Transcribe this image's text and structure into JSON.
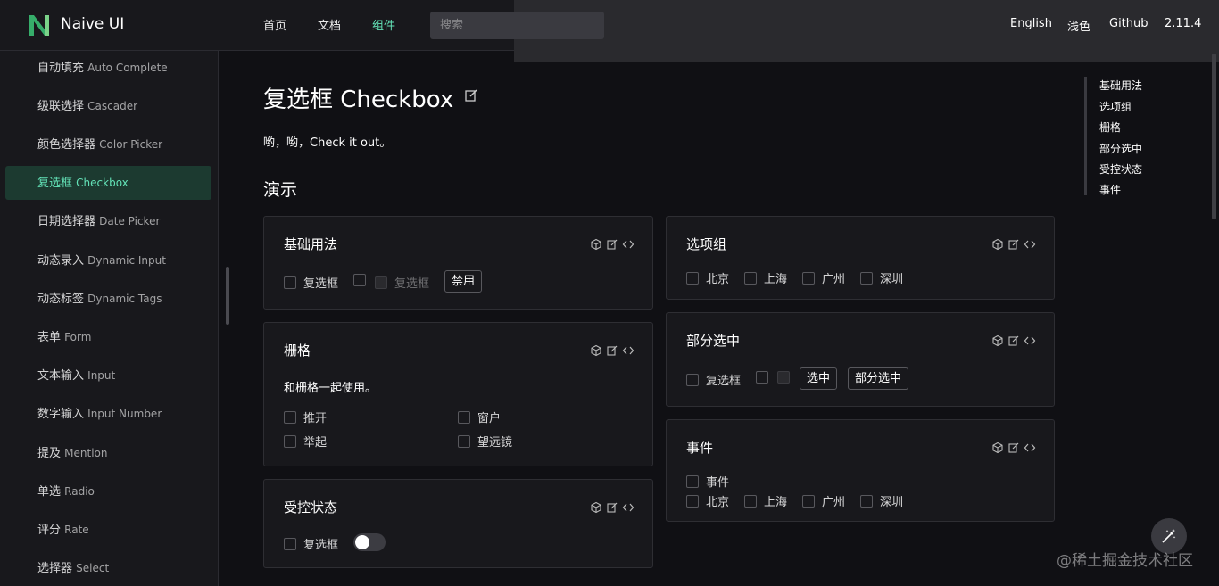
{
  "header": {
    "brand": "Naive UI",
    "nav": [
      "首页",
      "文档",
      "组件"
    ],
    "active_nav": "组件",
    "search_placeholder": "搜索",
    "right": [
      "English",
      "浅色",
      "Github",
      "2.11.4"
    ],
    "accent_color": "#63e2b7"
  },
  "sidebar": {
    "items": [
      {
        "zh": "自动填充",
        "en": "Auto Complete"
      },
      {
        "zh": "级联选择",
        "en": "Cascader"
      },
      {
        "zh": "颜色选择器",
        "en": "Color Picker"
      },
      {
        "zh": "复选框",
        "en": "Checkbox",
        "active": true
      },
      {
        "zh": "日期选择器",
        "en": "Date Picker"
      },
      {
        "zh": "动态录入",
        "en": "Dynamic Input"
      },
      {
        "zh": "动态标签",
        "en": "Dynamic Tags"
      },
      {
        "zh": "表单",
        "en": "Form"
      },
      {
        "zh": "文本输入",
        "en": "Input"
      },
      {
        "zh": "数字输入",
        "en": "Input Number"
      },
      {
        "zh": "提及",
        "en": "Mention"
      },
      {
        "zh": "单选",
        "en": "Radio"
      },
      {
        "zh": "评分",
        "en": "Rate"
      },
      {
        "zh": "选择器",
        "en": "Select"
      }
    ]
  },
  "main": {
    "title": "复选框 Checkbox",
    "intro": "哟，哟，Check it out。",
    "section": "演示",
    "cards": {
      "basic": {
        "title": "基础用法",
        "checkbox1": "复选框",
        "checkbox2": "复选框",
        "button": "禁用"
      },
      "grid": {
        "title": "栅格",
        "desc": "和栅格一起使用。",
        "items": [
          "推开",
          "窗户",
          "举起",
          "望远镜"
        ]
      },
      "controlled": {
        "title": "受控状态",
        "checkbox": "复选框",
        "switch_on": false
      },
      "group": {
        "title": "选项组",
        "items": [
          "北京",
          "上海",
          "广州",
          "深圳"
        ]
      },
      "partial": {
        "title": "部分选中",
        "checkbox": "复选框",
        "btn_checked": "选中",
        "btn_partial": "部分选中"
      },
      "event": {
        "title": "事件",
        "checkbox": "事件",
        "items": [
          "北京",
          "上海",
          "广州",
          "深圳"
        ]
      }
    }
  },
  "toc": [
    "基础用法",
    "选项组",
    "栅格",
    "部分选中",
    "受控状态",
    "事件"
  ],
  "watermark": "@稀土掘金技术社区"
}
